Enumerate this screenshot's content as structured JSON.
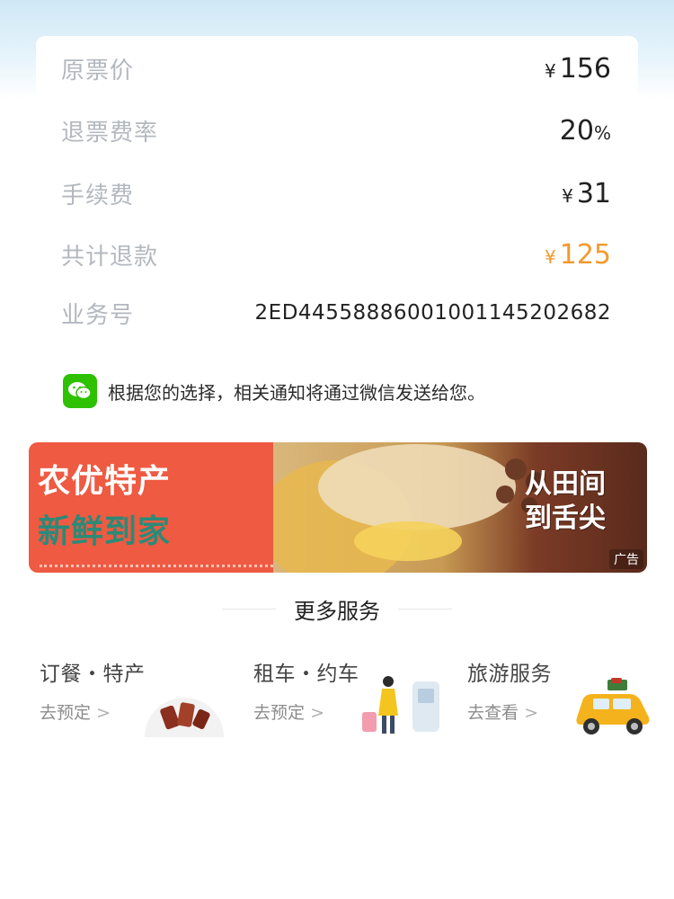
{
  "refund": {
    "original_label": "原票价",
    "original_currency": "¥",
    "original_value": "156",
    "rate_label": "退票费率",
    "rate_value": "20",
    "rate_unit": "%",
    "fee_label": "手续费",
    "fee_currency": "¥",
    "fee_value": "31",
    "total_label": "共计退款",
    "total_currency": "¥",
    "total_value": "125",
    "business_label": "业务号",
    "business_value": "2ED445588860010011452026​82"
  },
  "notice": {
    "text": "根据您的选择，相关通知将通过微信发送给您。"
  },
  "banner": {
    "left_line1": "农优特产",
    "left_line2": "新鲜到家",
    "slogan_line1": "从田间",
    "slogan_line2": "到舌尖",
    "ad_label": "广告"
  },
  "more": {
    "title": "更多服务"
  },
  "services": [
    {
      "title": "订餐・特产",
      "sub": "去预定",
      "chevron": ">"
    },
    {
      "title": "租车・约车",
      "sub": "去预定",
      "chevron": ">"
    },
    {
      "title": "旅游服务",
      "sub": "去查看",
      "chevron": ">"
    }
  ],
  "colors": {
    "accent_orange": "#f29a2e",
    "label_gray": "#b3b8bf",
    "wechat_green": "#2dc100"
  }
}
